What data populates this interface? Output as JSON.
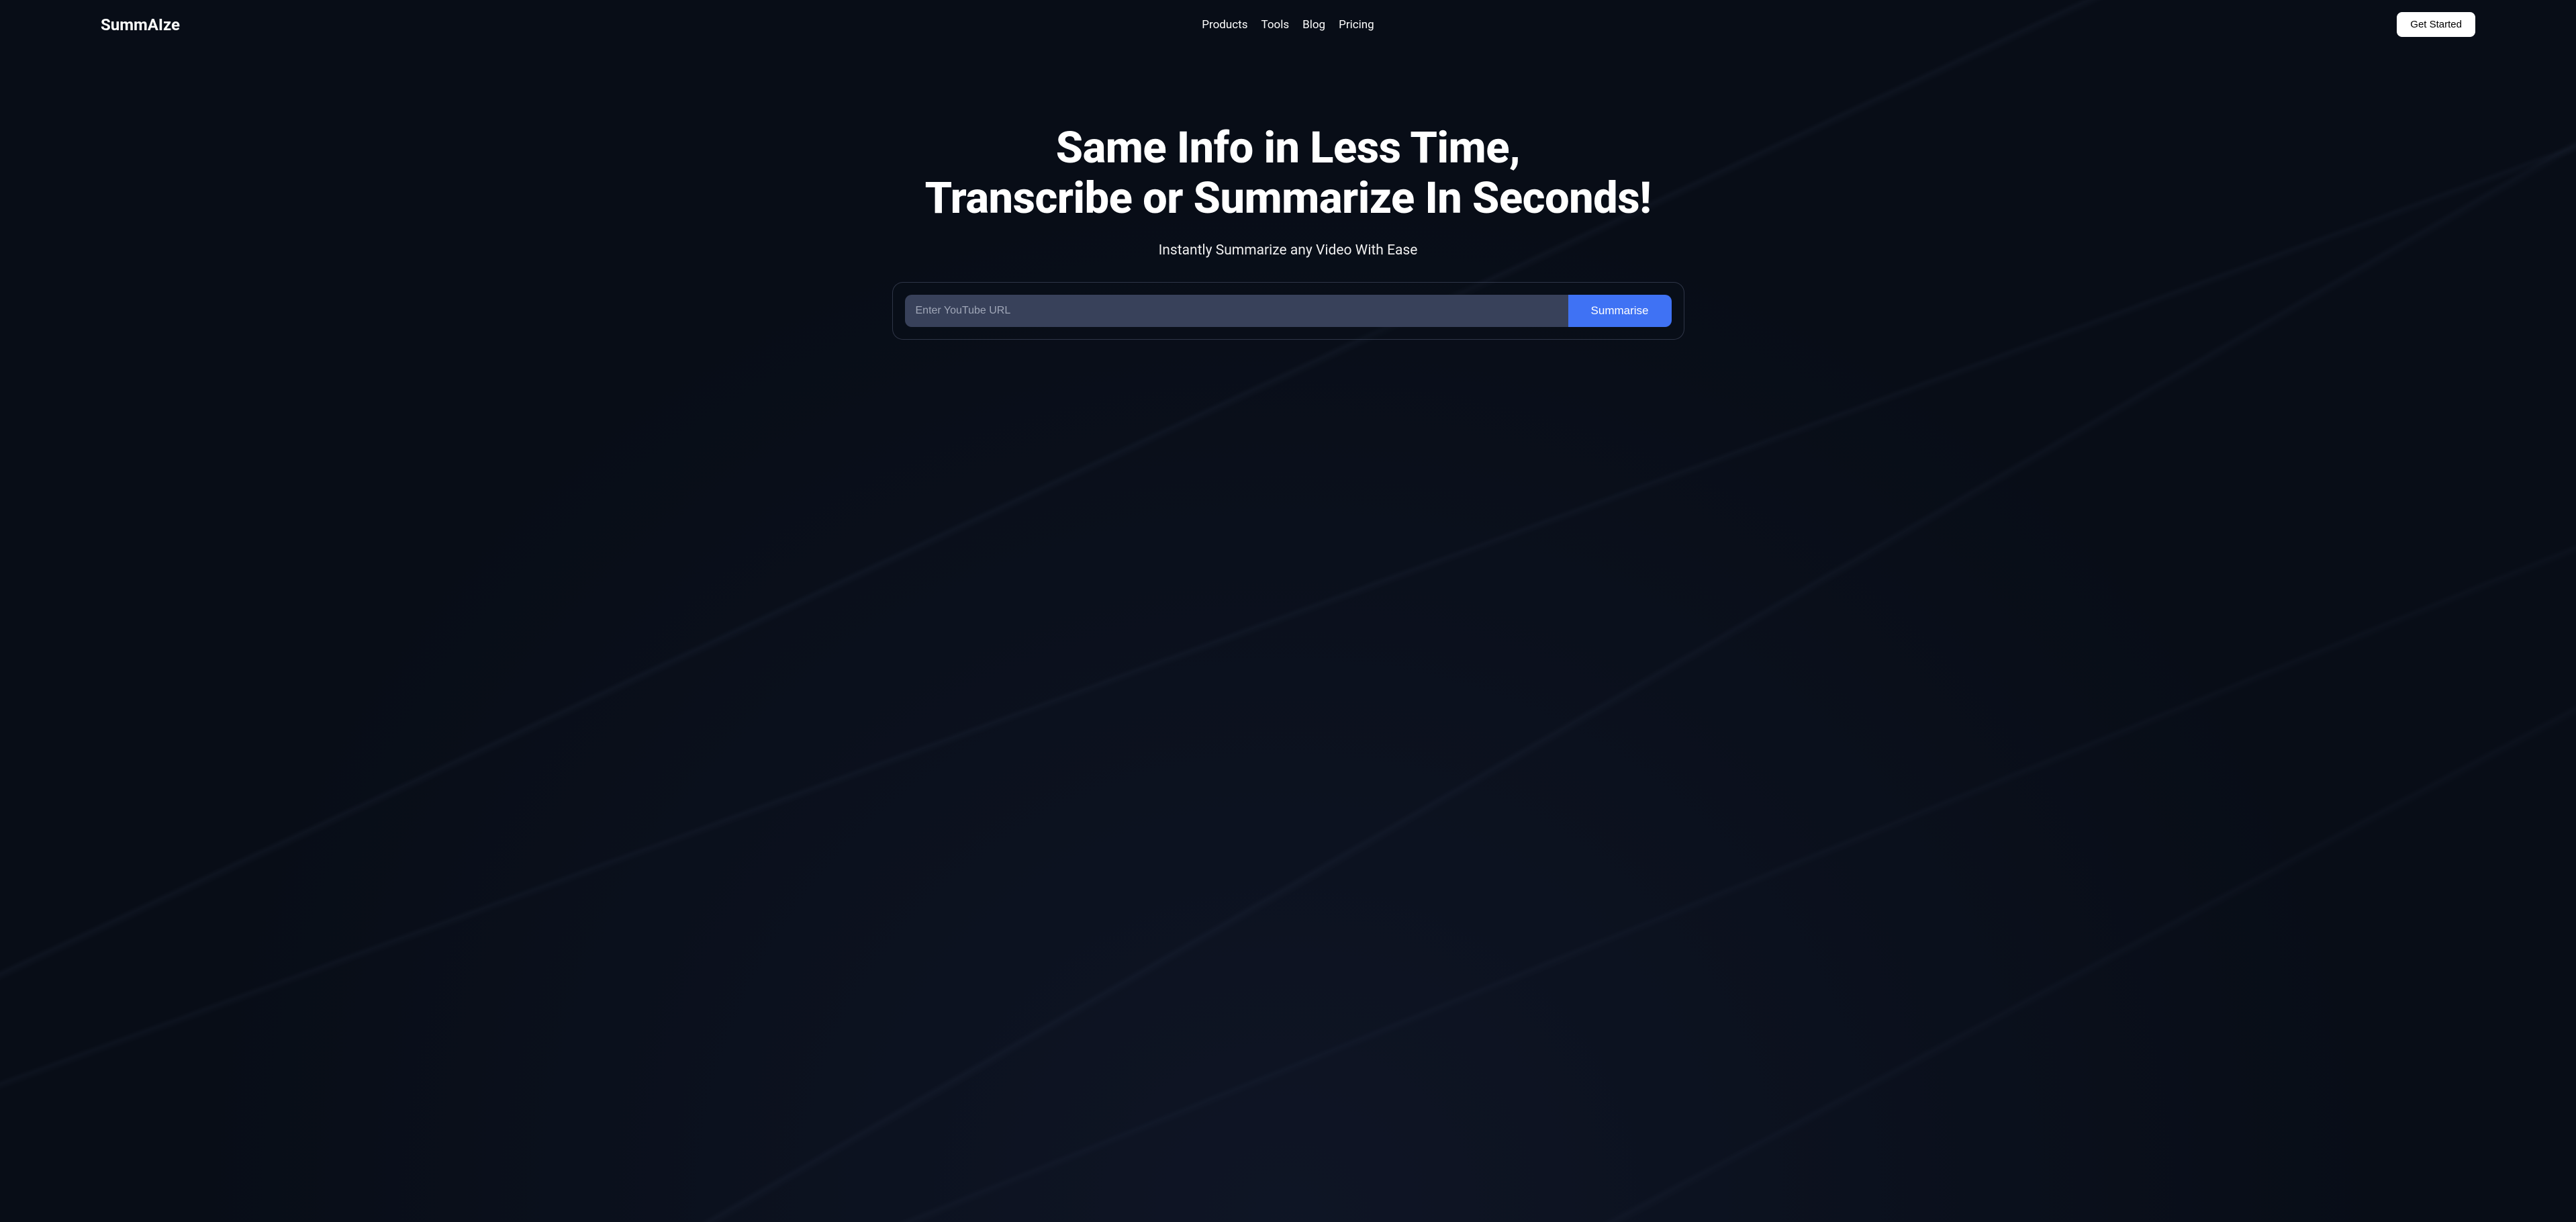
{
  "header": {
    "logo": "SummAIze",
    "nav": {
      "products": "Products",
      "tools": "Tools",
      "blog": "Blog",
      "pricing": "Pricing"
    },
    "cta_label": "Get Started"
  },
  "hero": {
    "title_line1": "Same Info in Less Time,",
    "title_line2": "Transcribe or Summarize In Seconds!",
    "subtitle": "Instantly Summarize any Video With Ease",
    "url_placeholder": "Enter YouTube URL",
    "url_value": "",
    "summarise_label": "Summarise"
  },
  "colors": {
    "background": "#080d17",
    "accent": "#3f72f4",
    "input_bg": "#38415a"
  }
}
